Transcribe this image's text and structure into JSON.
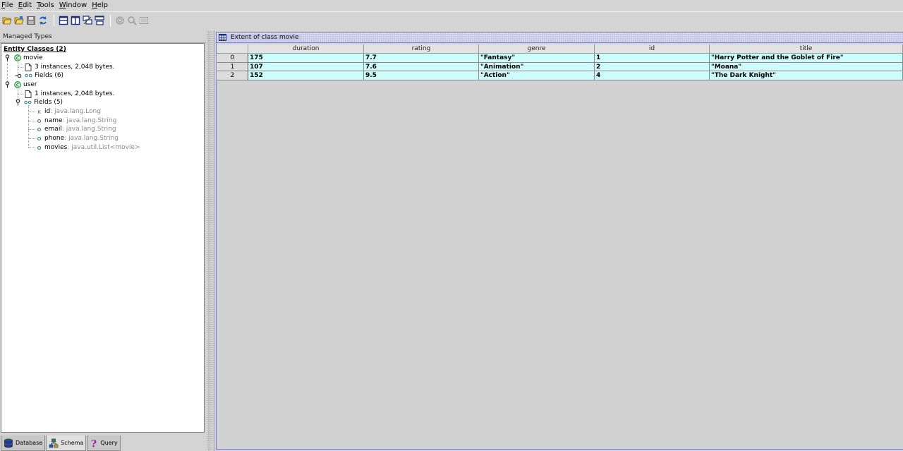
{
  "menu": [
    {
      "mnemonic": "F",
      "rest": "ile"
    },
    {
      "mnemonic": "E",
      "rest": "dit"
    },
    {
      "mnemonic": "T",
      "rest": "ools"
    },
    {
      "mnemonic": "W",
      "rest": "indow"
    },
    {
      "mnemonic": "H",
      "rest": "elp"
    }
  ],
  "left_panel": {
    "title": "Managed Types",
    "entity_root": "Entity Classes (2)",
    "movie": {
      "name": "movie",
      "instances": "3 instances, 2,048 bytes.",
      "fields": "Fields (6)"
    },
    "user": {
      "name": "user",
      "instances": "1 instances, 2,048 bytes.",
      "fields": "Fields (5)",
      "field_list": [
        {
          "name": "id",
          "type": " : java.lang.Long"
        },
        {
          "name": "name",
          "type": " : java.lang.String"
        },
        {
          "name": "email",
          "type": " : java.lang.String"
        },
        {
          "name": "phone",
          "type": " : java.lang.String"
        },
        {
          "name": "movies",
          "type": " : java.util.List<movie>"
        }
      ]
    }
  },
  "bottom_tabs": [
    "Database",
    "Schema",
    "Query"
  ],
  "result_window": {
    "title": "Extent of class movie",
    "columns": [
      "duration",
      "rating",
      "genre",
      "id",
      "title"
    ],
    "rows": [
      {
        "index": "0",
        "cells": [
          "175",
          "7.7",
          "\"Fantasy\"",
          "1",
          "\"Harry Potter and the Goblet of Fire\""
        ]
      },
      {
        "index": "1",
        "cells": [
          "107",
          "7.6",
          "\"Animation\"",
          "2",
          "\"Moana\""
        ]
      },
      {
        "index": "2",
        "cells": [
          "152",
          "9.5",
          "\"Action\"",
          "4",
          "\"The Dark Knight\""
        ]
      }
    ]
  },
  "colors": {
    "cell_bg": "#ccfcfc",
    "title_bar": "#c8c8ea",
    "class_icon": "#1d9a2e"
  }
}
